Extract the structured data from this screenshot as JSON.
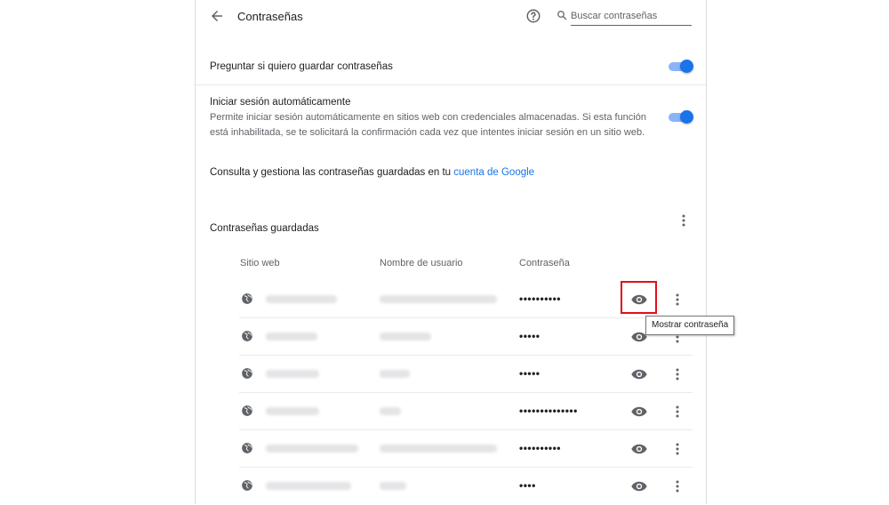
{
  "header": {
    "title": "Contraseñas",
    "search_placeholder": "Buscar contraseñas"
  },
  "settings": {
    "offer_to_save": {
      "label": "Preguntar si quiero guardar contraseñas",
      "enabled": true
    },
    "auto_signin": {
      "label": "Iniciar sesión automáticamente",
      "description": "Permite iniciar sesión automáticamente en sitios web con credenciales almacenadas. Si esta función está inhabilitada, se te solicitará la confirmación cada vez que intentes iniciar sesión en un sitio web.",
      "enabled": true
    },
    "manage_text": "Consulta y gestiona las contraseñas guardadas en tu ",
    "manage_link": "cuenta de Google"
  },
  "saved": {
    "heading": "Contraseñas guardadas",
    "columns": {
      "site": "Sitio web",
      "username": "Nombre de usuario",
      "password": "Contraseña"
    },
    "rows": [
      {
        "password": "••••••••••"
      },
      {
        "password": "•••••"
      },
      {
        "password": "•••••"
      },
      {
        "password": "••••••••••••••"
      },
      {
        "password": "••••••••••"
      },
      {
        "password": "••••"
      }
    ]
  },
  "tooltip": "Mostrar contraseña",
  "colors": {
    "accent": "#1a73e8",
    "highlight": "#e0101a"
  },
  "icons": [
    "arrow-back-icon",
    "help-icon",
    "search-icon",
    "more-vert-icon",
    "globe-icon",
    "eye-icon"
  ]
}
